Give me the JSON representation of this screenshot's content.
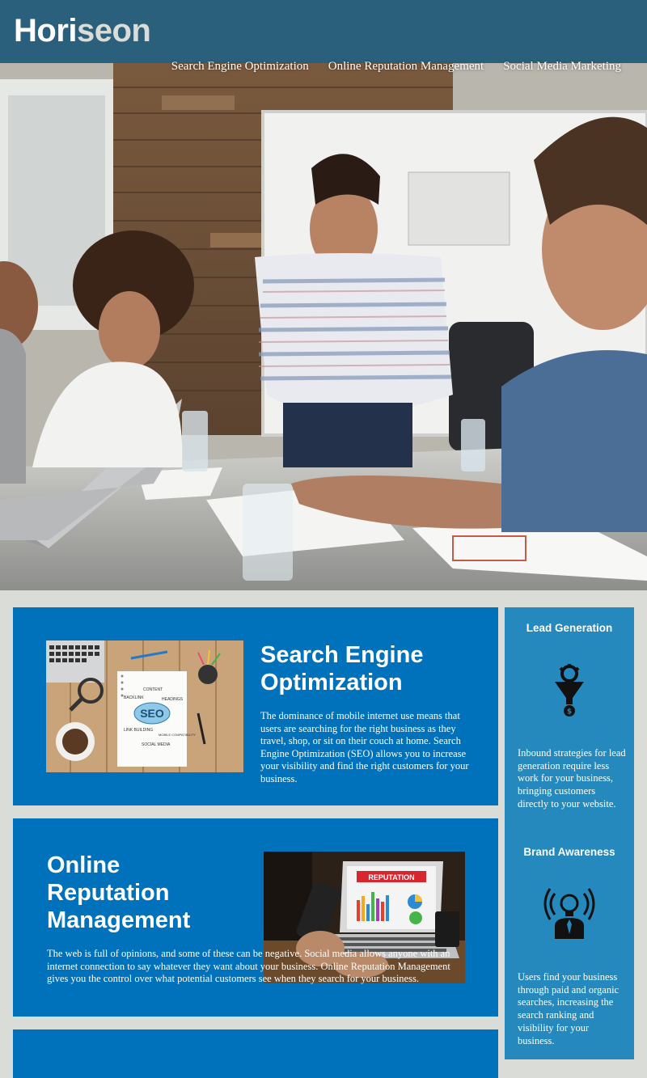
{
  "header": {
    "logo_main": "Hori",
    "logo_accent": "seon",
    "nav": [
      "Search Engine Optimization",
      "Online Reputation Management",
      "Social Media Marketing"
    ]
  },
  "main": {
    "seo": {
      "title_line1": "Search Engine",
      "title_line2": "Optimization",
      "body": "The dominance of mobile internet use means that users are searching for the right business as they travel, shop, or sit on their couch at home. Search Engine Optimization (SEO) allows you to increase your visibility and find the right customers for your business.",
      "image": {
        "seo_word": "SEO",
        "labels": [
          "CONTENT",
          "BACKLINK",
          "HEADINGS",
          "LINK BUILDING",
          "MOBILE COMPATIBILITY",
          "SOCIAL MEDIA"
        ]
      }
    },
    "orm": {
      "title_line1": "Online",
      "title_line2": "Reputation",
      "title_line3": "Management",
      "body": "The web is full of opinions, and some of these can be negative. Social media allows anyone with an internet connection to say whatever they want about your business. Online Reputation Management gives you the control over what potential customers see when they search for your business.",
      "image": {
        "screen_label": "REPUTATION"
      }
    }
  },
  "aside": {
    "lead": {
      "title": "Lead Generation",
      "icon": "lead-funnel-icon",
      "body": "Inbound strategies for lead generation require less work for your business, bringing customers directly to your website."
    },
    "brand": {
      "title": "Brand Awareness",
      "icon": "brand-lightbulb-icon",
      "body": "Users find your business through paid and organic searches, increasing the search ranking and visibility for your business."
    }
  },
  "colors": {
    "header": "#2a607c",
    "card": "#0072bb",
    "aside": "#2589bd",
    "page": "#d9dcd7"
  }
}
